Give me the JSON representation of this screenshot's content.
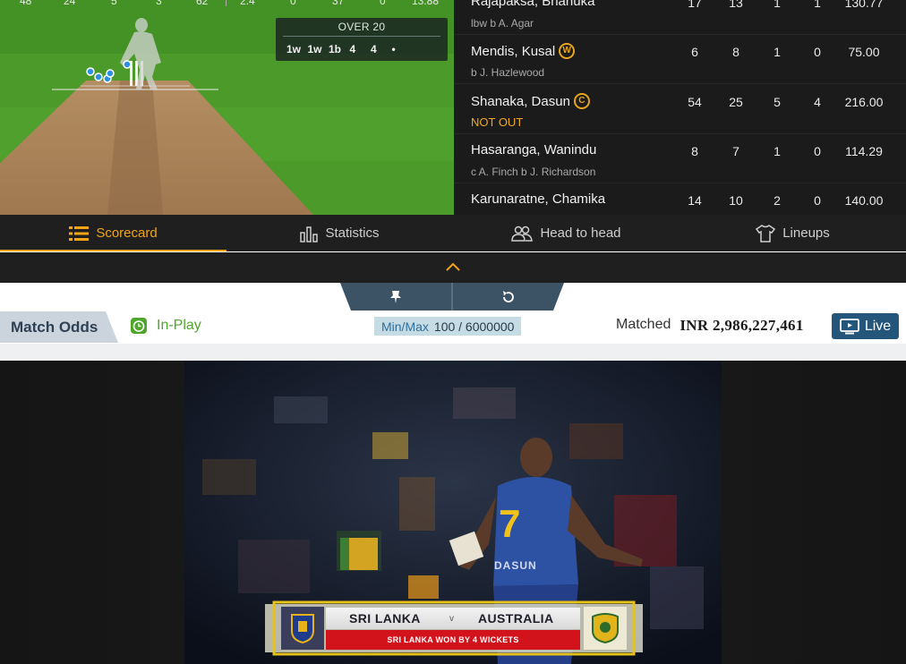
{
  "stats_strip": [
    "48",
    "24",
    "5",
    "3",
    "62",
    "2.4",
    "0",
    "37",
    "0",
    "13.88"
  ],
  "over": {
    "title": "OVER 20",
    "balls": [
      "1w",
      "1w",
      "1b",
      "4",
      "4",
      "•"
    ]
  },
  "batting": [
    {
      "name": "Rajapaksa, Bhanuka",
      "badge": "",
      "dismissal": "lbw b A. Agar",
      "runs": "17",
      "balls": "13",
      "fours": "1",
      "sixes": "1",
      "sr": "130.77"
    },
    {
      "name": "Mendis, Kusal",
      "badge": "W",
      "dismissal": "b J. Hazlewood",
      "runs": "6",
      "balls": "8",
      "fours": "1",
      "sixes": "0",
      "sr": "75.00"
    },
    {
      "name": "Shanaka, Dasun",
      "badge": "C",
      "dismissal": "NOT OUT",
      "runs": "54",
      "balls": "25",
      "fours": "5",
      "sixes": "4",
      "sr": "216.00"
    },
    {
      "name": "Hasaranga, Wanindu",
      "badge": "",
      "dismissal": "c A. Finch b J. Richardson",
      "runs": "8",
      "balls": "7",
      "fours": "1",
      "sixes": "0",
      "sr": "114.29"
    },
    {
      "name": "Karunaratne, Chamika",
      "badge": "",
      "dismissal": "",
      "runs": "14",
      "balls": "10",
      "fours": "2",
      "sixes": "0",
      "sr": "140.00"
    }
  ],
  "tabs": {
    "scorecard": "Scorecard",
    "statistics": "Statistics",
    "head_to_head": "Head to head",
    "lineups": "Lineups"
  },
  "market": {
    "title": "Match Odds",
    "status": "In-Play",
    "minmax_label": "Min/Max",
    "minmax_value": "100 / 6000000",
    "matched_label": "Matched",
    "matched_value": "INR 2,986,227,461",
    "live_label": "Live"
  },
  "broadcast": {
    "team1": "SRI LANKA",
    "vs": "v",
    "team2": "AUSTRALIA",
    "result": "SRI LANKA WON BY 4 WICKETS",
    "jersey_number": "7",
    "jersey_name": "DASUN"
  },
  "colors": {
    "accent": "#f2a516",
    "live_button": "#24567c",
    "inplay_green": "#4ea62a",
    "result_red": "#d3131c",
    "pitch_green": "#4c9a2a"
  }
}
